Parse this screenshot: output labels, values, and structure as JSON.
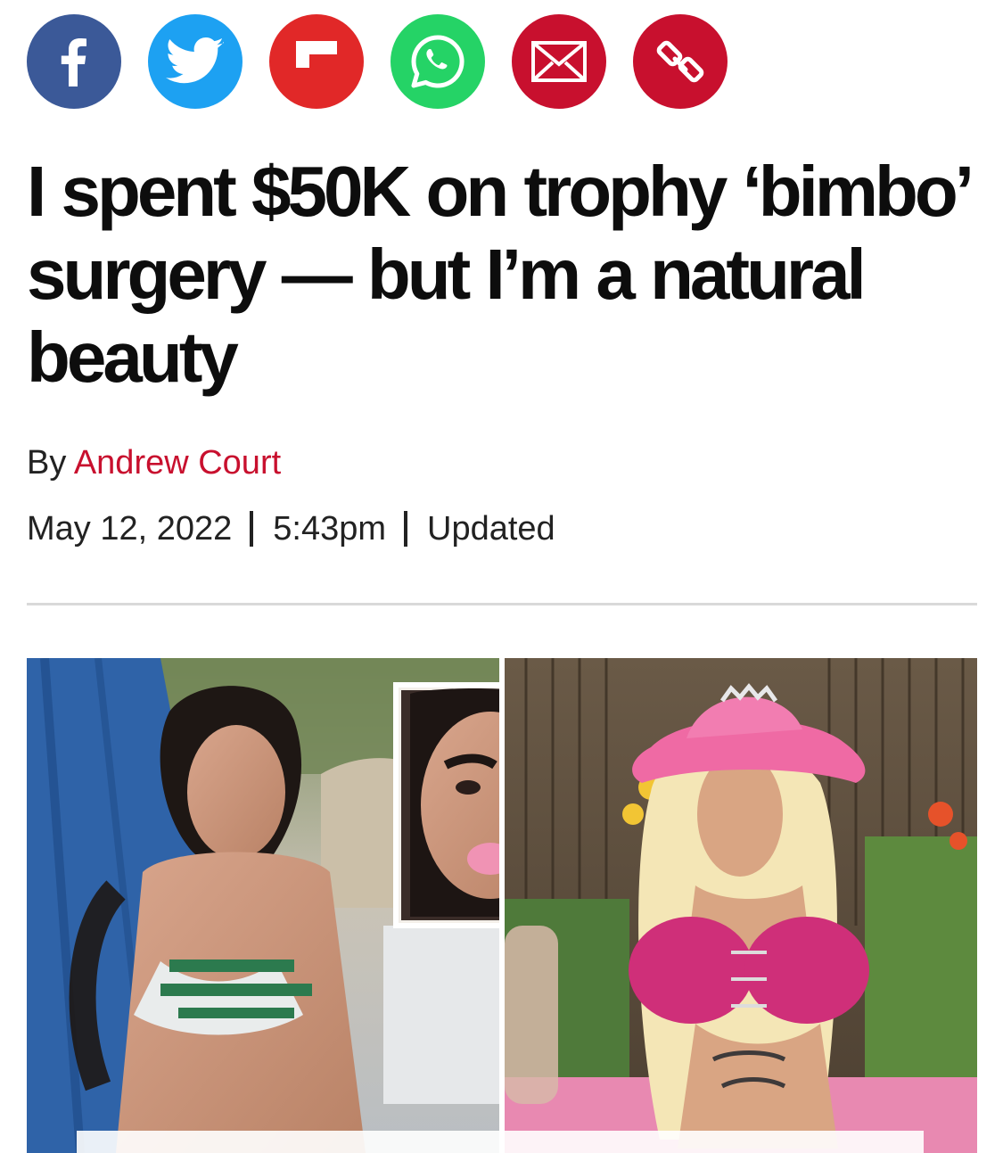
{
  "share": {
    "buttons": [
      {
        "id": "facebook",
        "icon": "facebook-icon",
        "color": "#3b5998"
      },
      {
        "id": "twitter",
        "icon": "twitter-bird-icon",
        "color": "#1da1f2"
      },
      {
        "id": "flipboard",
        "icon": "flipboard-icon",
        "color": "#e12828"
      },
      {
        "id": "whatsapp",
        "icon": "whatsapp-icon",
        "color": "#25d366"
      },
      {
        "id": "email",
        "icon": "envelope-icon",
        "color": "#c8102e"
      },
      {
        "id": "copy-link",
        "icon": "link-icon",
        "color": "#c8102e"
      }
    ]
  },
  "article": {
    "headline": "I spent $50K on trophy ‘bimbo’ surgery — but I’m a natural beauty",
    "byline_prefix": "By",
    "author": "Andrew Court",
    "date": "May 12, 2022",
    "time": "5:43pm",
    "updated_label": "Updated",
    "hero_image": "before-and-after photo collage"
  },
  "colors": {
    "accent": "#c8102e",
    "text": "#111111",
    "divider": "#d9d9d9"
  }
}
